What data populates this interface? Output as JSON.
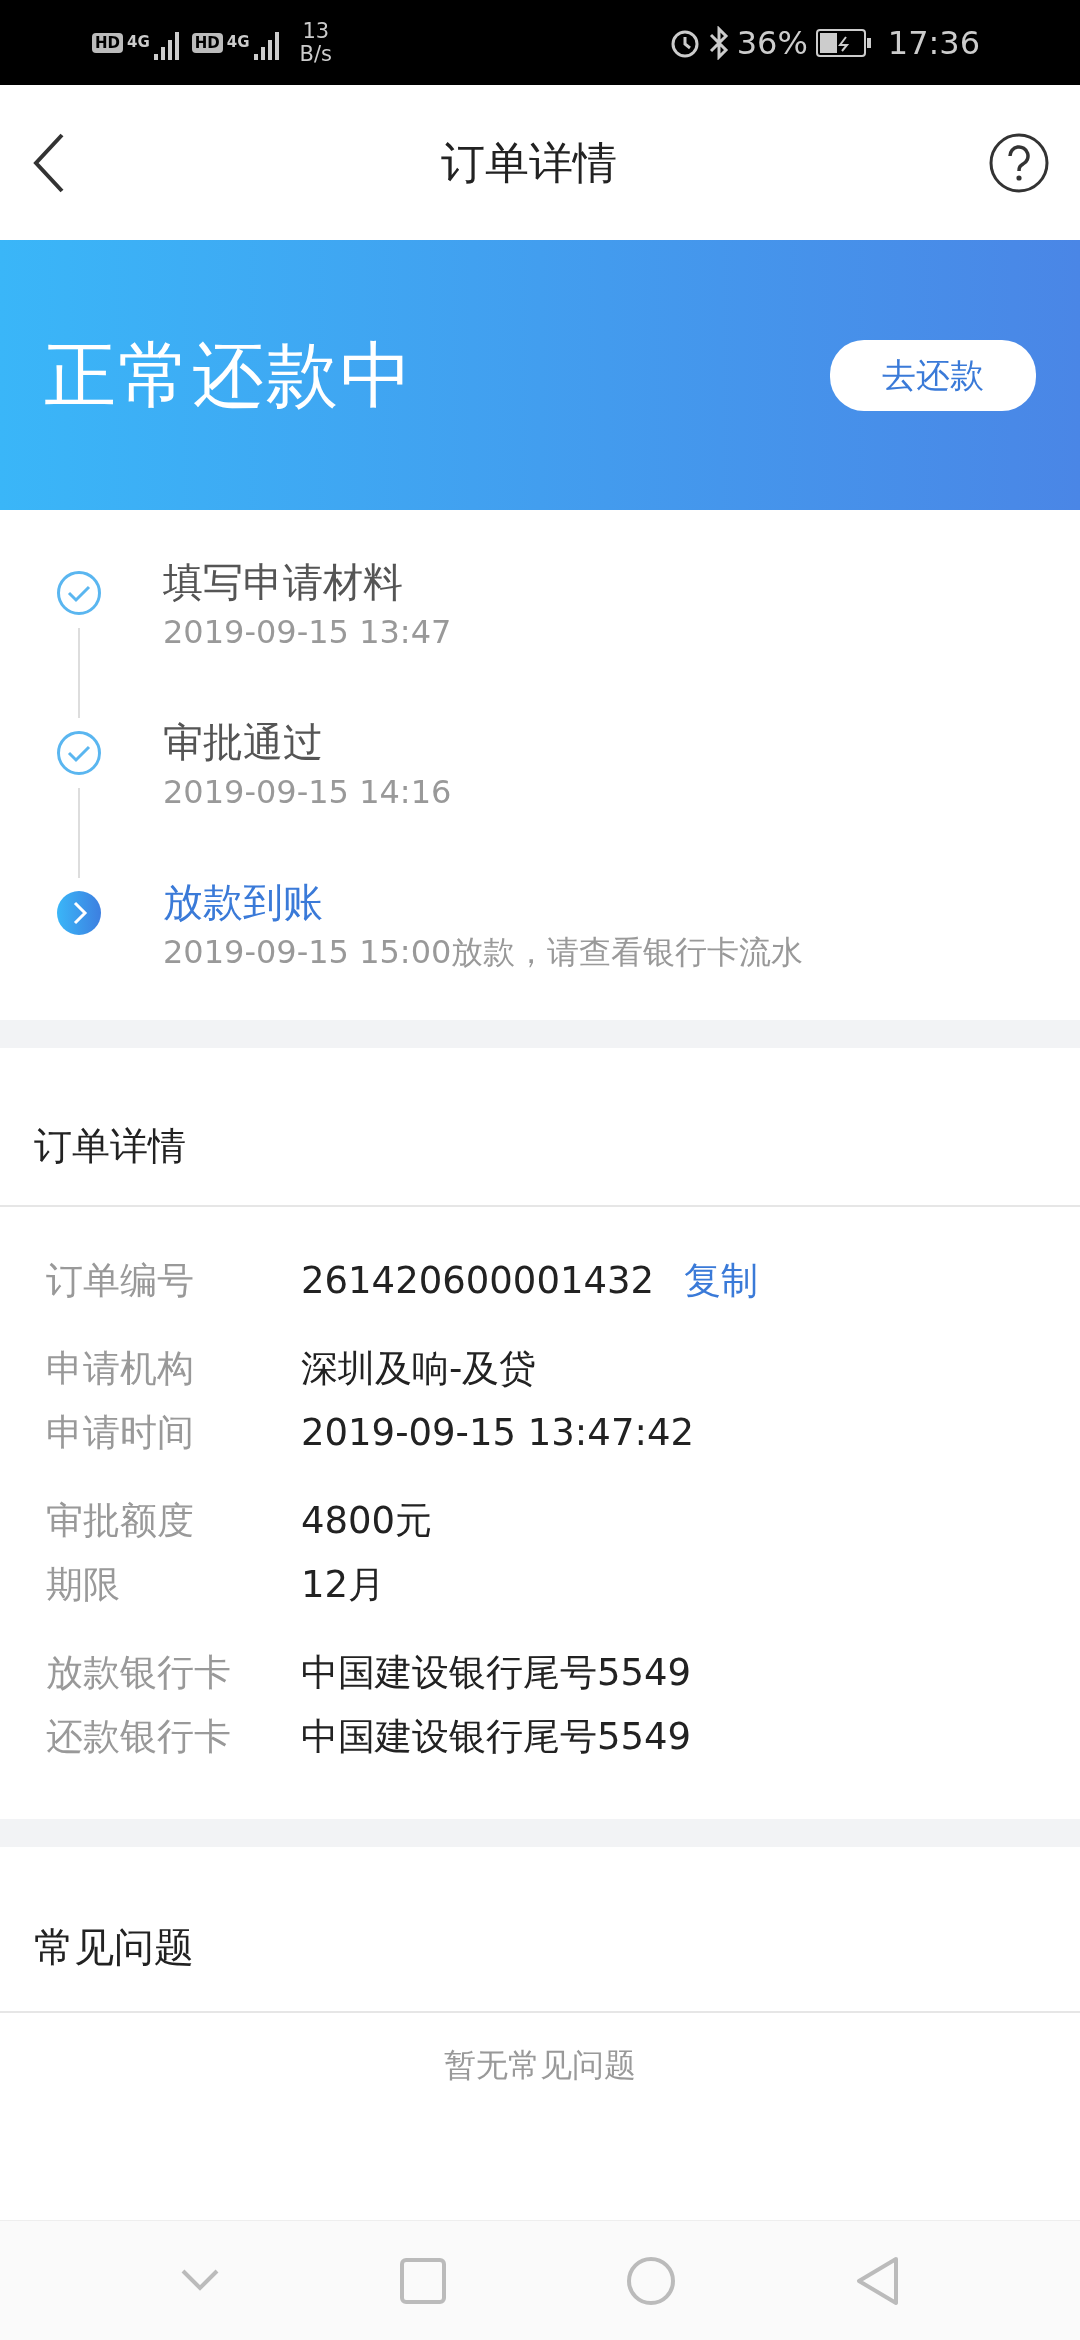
{
  "status_bar": {
    "sims": [
      {
        "hd": "HD",
        "network": "4G"
      },
      {
        "hd": "HD",
        "network": "4G"
      }
    ],
    "speed": "13",
    "speed_unit": "B/s",
    "battery": "36%",
    "time": "17:36"
  },
  "header": {
    "title": "订单详情"
  },
  "banner": {
    "status": "正常还款中",
    "button": "去还款"
  },
  "steps": [
    {
      "title": "填写申请材料",
      "detail": "2019-09-15 13:47",
      "kind": "done"
    },
    {
      "title": "审批通过",
      "detail": "2019-09-15 14:16",
      "kind": "done"
    },
    {
      "title": "放款到账",
      "detail": "2019-09-15 15:00放款，请查看银行卡流水",
      "kind": "current"
    }
  ],
  "order": {
    "title": "订单详情",
    "groups": [
      [
        {
          "label": "订单编号",
          "value": "261420600001432",
          "action": "复制"
        }
      ],
      [
        {
          "label": "申请机构",
          "value": "深圳及响-及贷"
        },
        {
          "label": "申请时间",
          "value": "2019-09-15 13:47:42"
        }
      ],
      [
        {
          "label": "审批额度",
          "value": "4800元"
        },
        {
          "label": "期限",
          "value": "12月"
        }
      ],
      [
        {
          "label": "放款银行卡",
          "value": "中国建设银行尾号5549"
        },
        {
          "label": "还款银行卡",
          "value": "中国建设银行尾号5549"
        }
      ]
    ]
  },
  "faq": {
    "title": "常见问题",
    "empty": "暂无常见问题"
  }
}
